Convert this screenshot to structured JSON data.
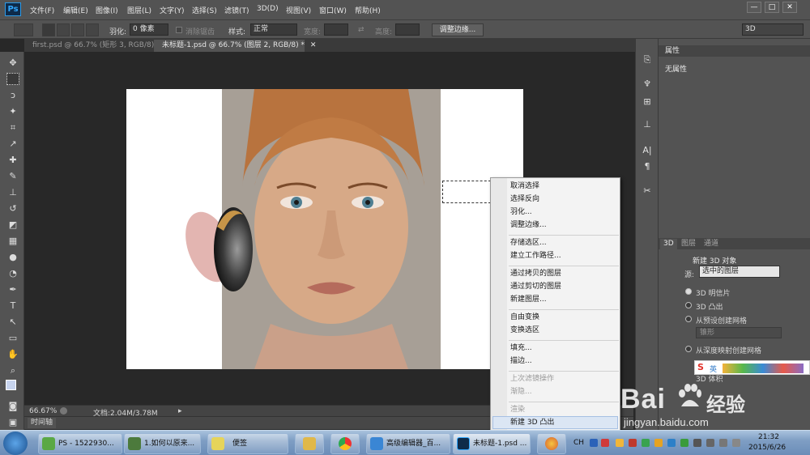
{
  "app": {
    "logo": "Ps"
  },
  "menu": [
    "文件(F)",
    "编辑(E)",
    "图像(I)",
    "图层(L)",
    "文字(Y)",
    "选择(S)",
    "滤镜(T)",
    "3D(D)",
    "视图(V)",
    "窗口(W)",
    "帮助(H)"
  ],
  "window_controls": {
    "minimize": "—",
    "restore": "□",
    "close": "✕"
  },
  "options": {
    "feather_label": "羽化:",
    "feather_value": "0 像素",
    "antialias_label": "消除锯齿",
    "style_label": "样式:",
    "style_value": "正常",
    "width_label": "宽度:",
    "height_label": "高度:",
    "refine_edge_button": "调整边缘...",
    "workspace_value": "3D"
  },
  "tabs": [
    {
      "label": "first.psd @ 66.7% (矩形 3, RGB/8) *",
      "close": "✕"
    },
    {
      "label": "未标题-1.psd @ 66.7% (图层 2, RGB/8) *",
      "close": "✕"
    }
  ],
  "status": {
    "zoom": "66.67%",
    "doc_info": "文档:2.04M/3.78M",
    "timeline": "时间轴"
  },
  "properties_panel": {
    "title": "属性",
    "content": "无属性"
  },
  "panel_3d": {
    "tabs": [
      "3D",
      "图层",
      "通道"
    ],
    "section_title": "新建 3D 对象",
    "source_label": "源:",
    "source_value": "选中的图层",
    "options": [
      "3D 明信片",
      "3D 凸出",
      "从预设创建网格",
      "从深度映射创建网格"
    ],
    "preset_value": "锥形",
    "volume_label": "3D 体积"
  },
  "context_menu": {
    "groups": [
      [
        {
          "label": "取消选择",
          "enabled": true
        },
        {
          "label": "选择反向",
          "enabled": true
        },
        {
          "label": "羽化...",
          "enabled": true
        },
        {
          "label": "调整边缘...",
          "enabled": true
        }
      ],
      [
        {
          "label": "存储选区...",
          "enabled": true
        },
        {
          "label": "建立工作路径...",
          "enabled": true
        }
      ],
      [
        {
          "label": "通过拷贝的图层",
          "enabled": true
        },
        {
          "label": "通过剪切的图层",
          "enabled": true
        },
        {
          "label": "新建图层...",
          "enabled": true
        }
      ],
      [
        {
          "label": "自由变换",
          "enabled": true
        },
        {
          "label": "变换选区",
          "enabled": true
        }
      ],
      [
        {
          "label": "填充...",
          "enabled": true
        },
        {
          "label": "描边...",
          "enabled": true
        }
      ],
      [
        {
          "label": "上次滤镜操作",
          "enabled": false
        },
        {
          "label": "渐隐...",
          "enabled": false
        }
      ],
      [
        {
          "label": "渲染",
          "enabled": false
        },
        {
          "label": "新建 3D 凸出",
          "enabled": true,
          "highlighted": true
        }
      ]
    ]
  },
  "taskbar": {
    "items": [
      {
        "label": "PS - 1522930...",
        "icon": "evernote-icon"
      },
      {
        "label": "1.如何以原来...",
        "icon": "notes-icon"
      },
      {
        "label": "便签",
        "icon": "sticky-icon"
      },
      {
        "label": "",
        "icon": "explorer-icon"
      },
      {
        "label": "",
        "icon": "chrome-icon"
      },
      {
        "label": "高级编辑器_百...",
        "icon": "browser-icon"
      },
      {
        "label": "未标题-1.psd ...",
        "icon": "photoshop-icon"
      },
      {
        "label": "",
        "icon": "paint-icon"
      }
    ],
    "lang": "CH",
    "time": "21:32",
    "date": "2015/6/26"
  },
  "watermark": {
    "brand": "Bai",
    "brand2": "经验",
    "url": "jingyan.baidu.com"
  },
  "colors": {
    "ps_blue": "#31a8ff",
    "panel_bg": "#535353",
    "canvas_bg": "#282828"
  }
}
